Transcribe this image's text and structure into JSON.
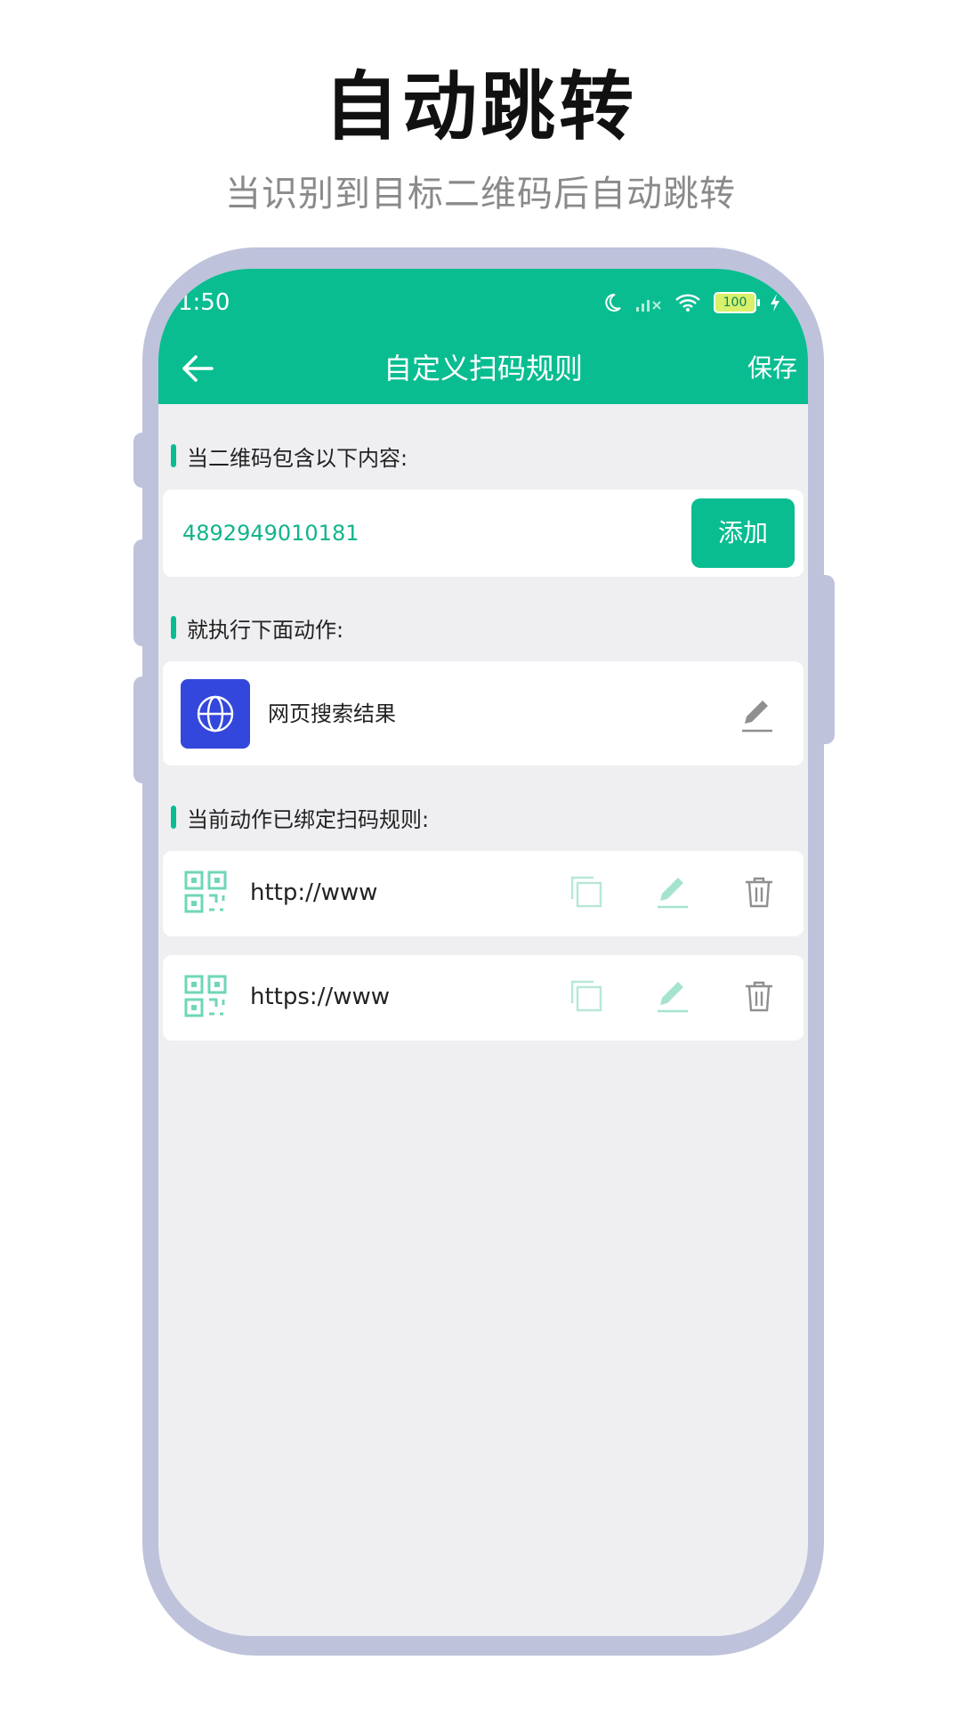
{
  "hero": {
    "title": "自动跳转",
    "subtitle": "当识别到目标二维码后自动跳转"
  },
  "status_bar": {
    "time": "1:50",
    "battery": "100"
  },
  "header": {
    "title": "自定义扫码规则",
    "save_label": "保存"
  },
  "section_contains": {
    "label": "当二维码包含以下内容:",
    "input_value": "4892949010181",
    "add_label": "添加"
  },
  "section_action": {
    "label": "就执行下面动作:",
    "action_label": "网页搜索结果"
  },
  "section_bound": {
    "label": "当前动作已绑定扫码规则:",
    "rules": [
      {
        "text": "http://www"
      },
      {
        "text": "https://www"
      }
    ]
  },
  "colors": {
    "brand": "#09bd91",
    "action_icon_bg": "#3447dc",
    "frame": "#bec2db",
    "screen_bg": "#efeff2"
  }
}
